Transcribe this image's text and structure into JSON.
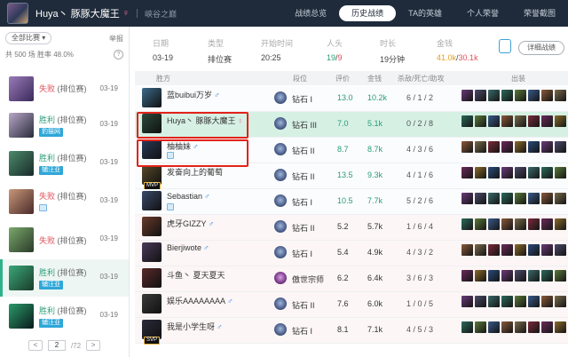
{
  "topbar": {
    "name": "Huya丶 豚豚大魔王",
    "sex": "♀",
    "server": "峡谷之巅",
    "tabs": [
      {
        "label": "战绩总览",
        "active": false
      },
      {
        "label": "历史战绩",
        "active": true
      },
      {
        "label": "TA的英雄",
        "active": false
      },
      {
        "label": "个人荣誉",
        "active": false
      },
      {
        "label": "荣誉截图",
        "active": false
      }
    ]
  },
  "sidebar": {
    "filter": "全部比赛 ▾",
    "report": "举报",
    "stats": "共 500 场   胜率 48.0%",
    "help": "?",
    "matches": [
      {
        "result": "失败",
        "mode": "(排位赛)",
        "date": "03-19",
        "badge": "",
        "hero_color": "#6a5a9a"
      },
      {
        "result": "胜利",
        "mode": "(排位赛)",
        "date": "03-19",
        "badge": "豹猫网",
        "hero_color": "#3a3a4a"
      },
      {
        "result": "胜利",
        "mode": "(排位赛)",
        "date": "03-19",
        "badge": "辅汪亚",
        "hero_color": "#2a4a3a"
      },
      {
        "result": "失败",
        "mode": "(排位赛)",
        "date": "03-19",
        "badge": "",
        "hero_color": "#6a4a3a"
      },
      {
        "result": "失败",
        "mode": "(排位赛)",
        "date": "03-19",
        "badge": "",
        "hero_color": "#3a5a3a"
      },
      {
        "result": "胜利",
        "mode": "(排位赛)",
        "date": "03-19",
        "badge": "辅汪亚",
        "hero_color": "#2a5a4a"
      },
      {
        "result": "胜利",
        "mode": "(排位赛)",
        "date": "03-19",
        "badge": "辅汪亚",
        "hero_color": "#1a3a2a"
      }
    ],
    "pager": {
      "prev": "<",
      "page": "2",
      "total": "/72",
      "next": ">"
    }
  },
  "summary": {
    "date_label": "日期",
    "date": "03-19",
    "type_label": "类型",
    "type": "排位赛",
    "start_label": "开始时间",
    "start": "20:25",
    "heads_label": "人头",
    "heads_a": "19",
    "heads_b": "9",
    "duration_label": "时长",
    "duration": "19分钟",
    "gold_label": "金钱",
    "gold_a": "41.0k",
    "gold_b": "30.1k",
    "detail_button": "详细战绩"
  },
  "table": {
    "headers": {
      "result": "胜方",
      "tier": "段位",
      "score": "评价",
      "gold": "金钱",
      "kda": "杀敌/死亡/助攻",
      "items": "出装"
    },
    "rows": [
      {
        "name": "蓝buibui万岁",
        "sex": "♂",
        "sex_key": "m",
        "tier": "钻石 I",
        "score": "13.0",
        "gold": "10.2k",
        "kda": "6 / 1 / 2",
        "team": "a",
        "champ": "#3a6a8a",
        "mvp": "",
        "sub": false
      },
      {
        "name": "Huya丶 豚豚大魔王",
        "sex": "♀",
        "sex_key": "f",
        "tier": "钻石 III",
        "score": "7.0",
        "gold": "5.1k",
        "kda": "0 / 2 / 8",
        "team": "hl",
        "champ": "#2a4a3a",
        "mvp": "",
        "sub": false
      },
      {
        "name": "柚柚妹",
        "sex": "♂",
        "sex_key": "m",
        "tier": "钻石 II",
        "score": "8.7",
        "gold": "8.7k",
        "kda": "4 / 3 / 6",
        "team": "a",
        "champ": "#2a3a5a",
        "mvp": "",
        "sub": true
      },
      {
        "name": "发奋向上的葡萄",
        "sex": "",
        "sex_key": "m",
        "tier": "钻石 II",
        "score": "13.5",
        "gold": "9.3k",
        "kda": "4 / 1 / 6",
        "team": "a",
        "champ": "#5a4a2a",
        "mvp": "MVP",
        "sub": false
      },
      {
        "name": "Sebastian",
        "sex": "♂",
        "sex_key": "m",
        "tier": "钻石 I",
        "score": "10.5",
        "gold": "7.7k",
        "kda": "5 / 2 / 6",
        "team": "a",
        "champ": "#3a4a6a",
        "mvp": "",
        "sub": true
      },
      {
        "name": "虎牙GIZZY",
        "sex": "♂",
        "sex_key": "m",
        "tier": "钻石 II",
        "score": "5.2",
        "gold": "5.7k",
        "kda": "1 / 6 / 4",
        "team": "b",
        "champ": "#6a3a2a",
        "mvp": "",
        "sub": false
      },
      {
        "name": "Bierjiwote",
        "sex": "♂",
        "sex_key": "m",
        "tier": "钻石 I",
        "score": "5.4",
        "gold": "4.9k",
        "kda": "4 / 3 / 2",
        "team": "b",
        "champ": "#4a3a5a",
        "mvp": "",
        "sub": false
      },
      {
        "name": "斗鱼丶 夏天夏天",
        "sex": "",
        "sex_key": "m",
        "tier": "傲世宗师",
        "score": "6.2",
        "gold": "6.4k",
        "kda": "3 / 6 / 3",
        "team": "b",
        "champ": "#5a2a2a",
        "mvp": "",
        "sub": false,
        "master": true
      },
      {
        "name": "娱乐AAAAAAAA",
        "sex": "♂",
        "sex_key": "m",
        "tier": "钻石 II",
        "score": "7.6",
        "gold": "6.0k",
        "kda": "1 / 0 / 5",
        "team": "b",
        "champ": "#3a3a3a",
        "mvp": "",
        "sub": false
      },
      {
        "name": "我是小学生呀",
        "sex": "♂",
        "sex_key": "m",
        "tier": "钻石 I",
        "score": "8.1",
        "gold": "7.1k",
        "kda": "4 / 5 / 3",
        "team": "b",
        "champ": "#2a2a3a",
        "mvp": "SVP",
        "sub": false
      }
    ]
  }
}
